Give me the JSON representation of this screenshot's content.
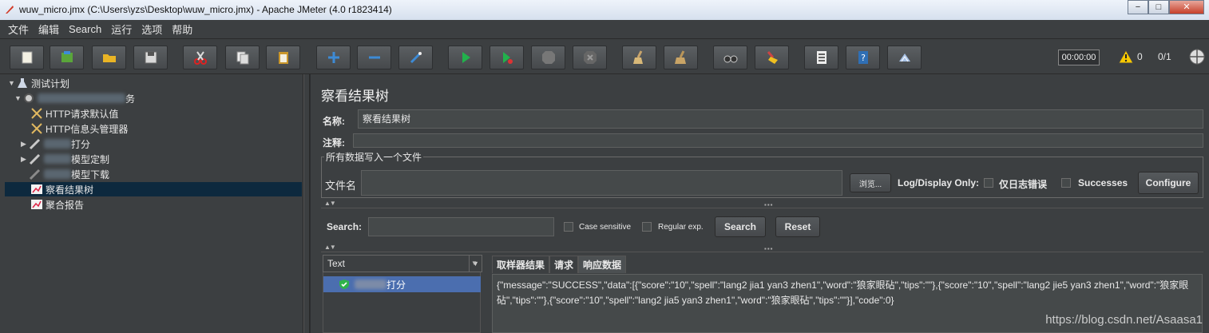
{
  "window": {
    "title": "wuw_micro.jmx (C:\\Users\\yzs\\Desktop\\wuw_micro.jmx) - Apache JMeter (4.0 r1823414)",
    "minimize": "−",
    "maximize": "□",
    "close": "✕"
  },
  "menu": [
    "文件",
    "编辑",
    "Search",
    "运行",
    "选项",
    "帮助"
  ],
  "toolbar": {
    "timer": "00:00:00",
    "warnings": "0",
    "threads": "0/1",
    "colors": {
      "run": "#22b14c",
      "add": "#3d8bd6"
    }
  },
  "tree": {
    "root": "测试计划",
    "thread_group_suffix": "务",
    "items": [
      {
        "label": "HTTP请求默认值"
      },
      {
        "label": "HTTP信息头管理器"
      },
      {
        "label": "打分"
      },
      {
        "label": "模型定制"
      },
      {
        "label": "模型下载"
      },
      {
        "label": "察看结果树"
      },
      {
        "label": "聚合报告"
      }
    ]
  },
  "panel": {
    "title": "察看结果树",
    "name_label": "名称:",
    "name_value": "察看结果树",
    "comment_label": "注释:",
    "comment_value": "",
    "group_title": "所有数据写入一个文件",
    "filename_label": "文件名",
    "browse": "浏览...",
    "log_display_only": "Log/Display Only:",
    "errors_only": "仅日志错误",
    "successes": "Successes",
    "configure": "Configure",
    "search_label": "Search:",
    "search_value": "",
    "case_sensitive": "Case sensitive",
    "regular_exp": "Regular exp.",
    "search_btn": "Search",
    "reset_btn": "Reset",
    "renderer": "Text",
    "result_item": "打分",
    "tabs": [
      "取样器结果",
      "请求",
      "响应数据"
    ],
    "response": "{\"message\":\"SUCCESS\",\"data\":[{\"score\":\"10\",\"spell\":\"lang2 jia1 yan3 zhen1\",\"word\":\"狼家眼砧\",\"tips\":\"\"},{\"score\":\"10\",\"spell\":\"lang2 jie5 yan3 zhen1\",\"word\":\"狼家眼砧\",\"tips\":\"\"},{\"score\":\"10\",\"spell\":\"lang2 jia5 yan3 zhen1\",\"word\":\"狼家眼砧\",\"tips\":\"\"}],\"code\":0}"
  },
  "watermark": "https://blog.csdn.net/Asaasa1"
}
